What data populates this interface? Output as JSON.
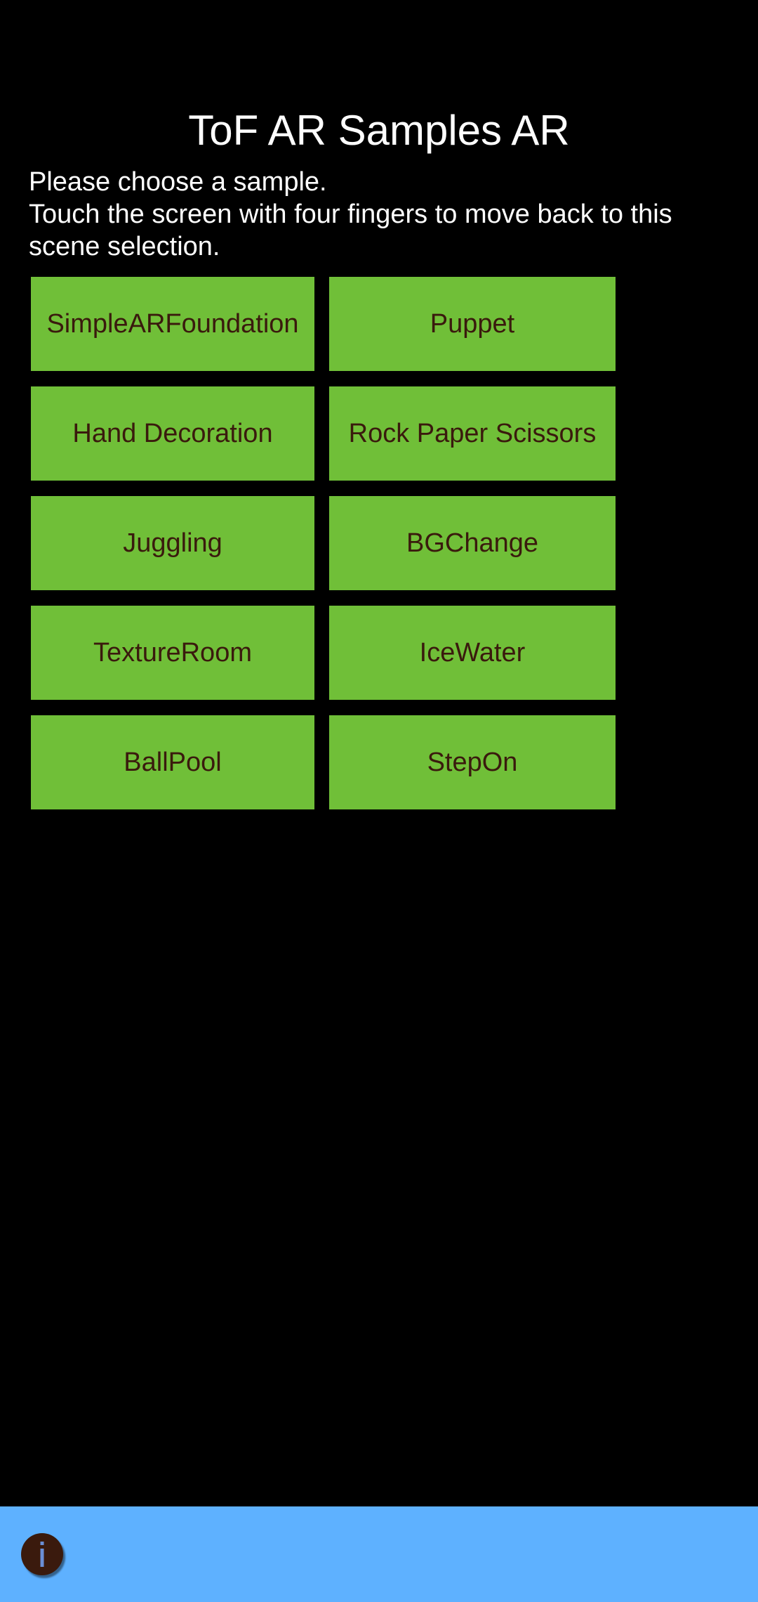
{
  "app": {
    "title": "ToF AR Samples AR"
  },
  "instructions": {
    "line1": "Please choose a sample.",
    "line2": "Touch the screen with four fingers to move back to this",
    "line3": "scene selection."
  },
  "samples": [
    {
      "label": "SimpleARFoundation"
    },
    {
      "label": "Puppet"
    },
    {
      "label": "Hand Decoration"
    },
    {
      "label": "Rock Paper Scissors"
    },
    {
      "label": "Juggling"
    },
    {
      "label": "BGChange"
    },
    {
      "label": "TextureRoom"
    },
    {
      "label": "IceWater"
    },
    {
      "label": "BallPool"
    },
    {
      "label": "StepOn"
    }
  ],
  "bottom_bar": {
    "info_icon": "info-icon"
  },
  "colors": {
    "background": "#000000",
    "button": "#70bf38",
    "button_text": "#3a1a0d",
    "bottom_bar": "#5eb1ff",
    "info_button": "#3a1a0d"
  }
}
